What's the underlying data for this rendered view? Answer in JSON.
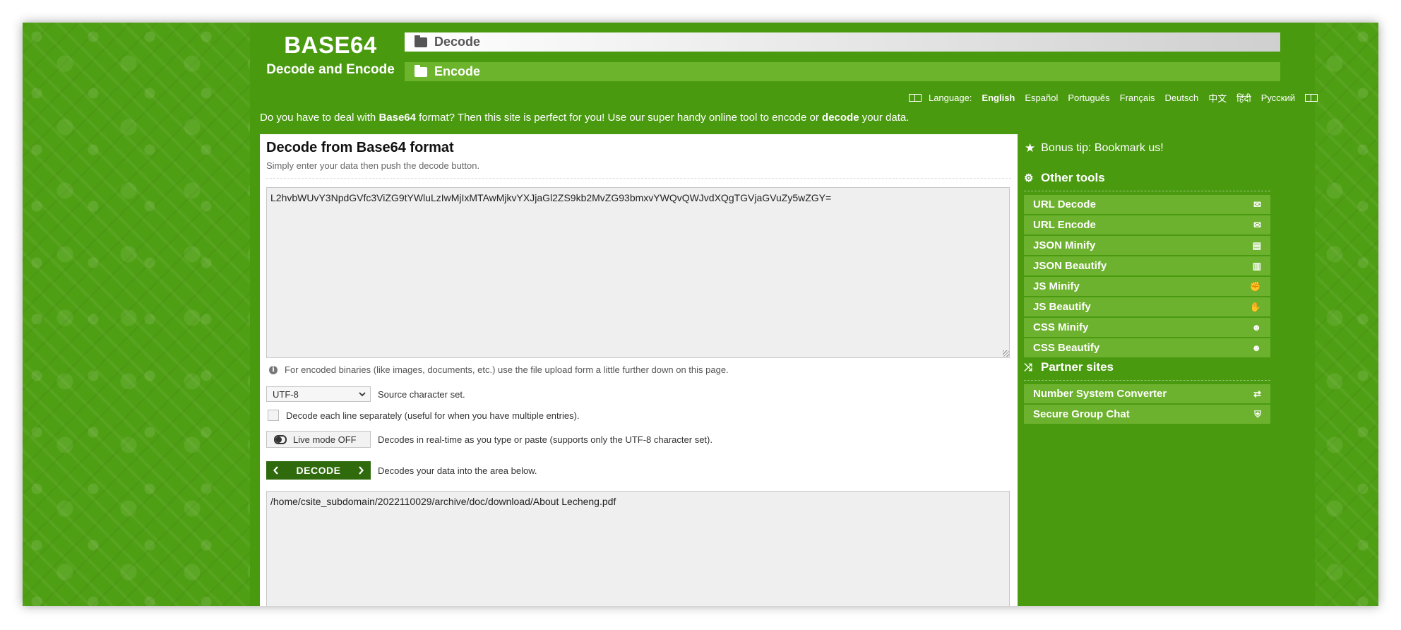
{
  "logo": {
    "title": "BASE64",
    "subtitle": "Decode and Encode"
  },
  "nav": {
    "decode": "Decode",
    "encode": "Encode"
  },
  "language": {
    "label": "Language:",
    "items": [
      "English",
      "Español",
      "Português",
      "Français",
      "Deutsch",
      "中文",
      "हिंदी",
      "Русский"
    ],
    "active": "English"
  },
  "intro": {
    "p1": "Do you have to deal with ",
    "b1": "Base64",
    "p2": " format? Then this site is perfect for you! Use our super handy online tool to encode or ",
    "b2": "decode",
    "p3": " your data."
  },
  "panel": {
    "title": "Decode from Base64 format",
    "subtitle": "Simply enter your data then push the decode button.",
    "input_value": "L2hvbWUvY3NpdGVfc3ViZG9tYWluLzIwMjIxMTAwMjkvYXJjaGl2ZS9kb2MvZG93bmxvYWQvQWJvdXQgTGVjaGVuZy5wZGY=",
    "info_text": "For encoded binaries (like images, documents, etc.) use the file upload form a little further down on this page.",
    "charset_value": "UTF-8",
    "charset_label": "Source character set.",
    "line_label": "Decode each line separately (useful for when you have multiple entries).",
    "live_label": "Live mode OFF",
    "live_desc": "Decodes in real-time as you type or paste (supports only the UTF-8 character set).",
    "decode_label": "DECODE",
    "decode_desc": "Decodes your data into the area below.",
    "output_value": "/home/csite_subdomain/2022110029/archive/doc/download/About Lecheng.pdf"
  },
  "sidebar": {
    "tip": "Bonus tip: Bookmark us!",
    "other_tools_title": "Other tools",
    "tools": [
      {
        "label": "URL Decode",
        "icon": "envelope-open-icon"
      },
      {
        "label": "URL Encode",
        "icon": "envelope-icon"
      },
      {
        "label": "JSON Minify",
        "icon": "file-zip-icon"
      },
      {
        "label": "JSON Beautify",
        "icon": "file-code-icon"
      },
      {
        "label": "JS Minify",
        "icon": "fist-icon"
      },
      {
        "label": "JS Beautify",
        "icon": "hand-icon"
      },
      {
        "label": "CSS Minify",
        "icon": "smile-icon"
      },
      {
        "label": "CSS Beautify",
        "icon": "grin-icon"
      }
    ],
    "partner_title": "Partner sites",
    "partners": [
      {
        "label": "Number System Converter",
        "icon": "exchange-icon"
      },
      {
        "label": "Secure Group Chat",
        "icon": "shield-icon"
      }
    ]
  }
}
